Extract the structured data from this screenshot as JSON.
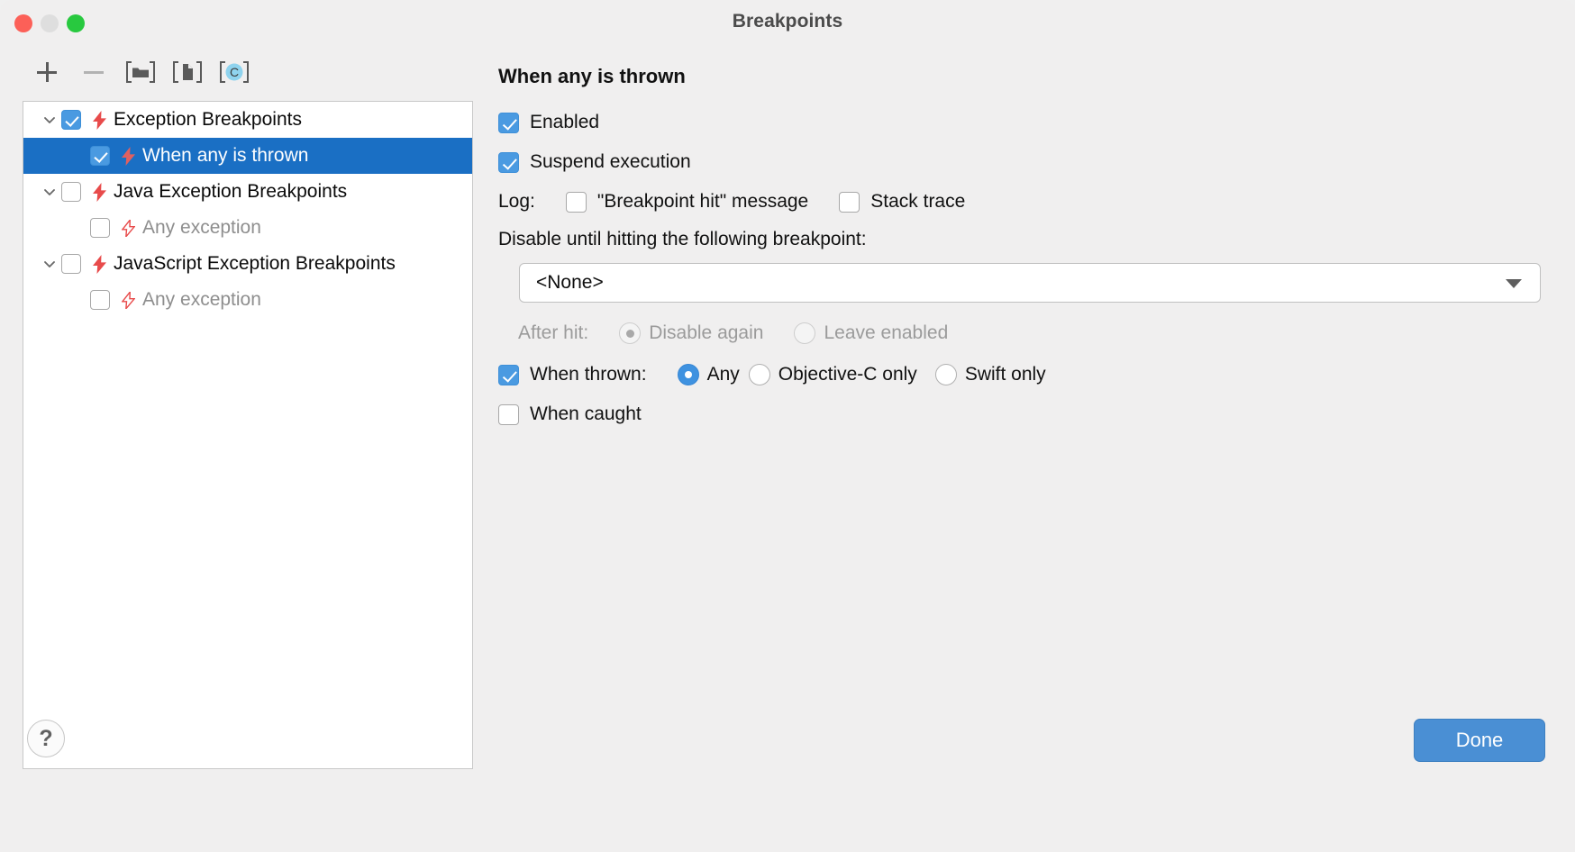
{
  "window": {
    "title": "Breakpoints",
    "traffic_lights": [
      "close",
      "minimize",
      "zoom"
    ]
  },
  "toolbar": {
    "items": [
      {
        "name": "add-breakpoint-button",
        "icon": "plus-icon",
        "label": "+"
      },
      {
        "name": "remove-breakpoint-button",
        "icon": "minus-icon",
        "label": "–"
      },
      {
        "name": "move-to-folder-button",
        "icon": "folder-bracket-icon",
        "label": ""
      },
      {
        "name": "share-breakpoint-button",
        "icon": "file-bracket-icon",
        "label": ""
      },
      {
        "name": "c-breakpoint-button",
        "icon": "c-bracket-icon",
        "label": "C"
      }
    ]
  },
  "list": {
    "rows": [
      {
        "label": "Exception Breakpoints",
        "checkbox": "checked",
        "disclosure": "expanded",
        "icon": "bolt-icon",
        "level": 1,
        "selected": false,
        "dim": false
      },
      {
        "label": "When any is thrown",
        "checkbox": "checked",
        "disclosure": "none",
        "icon": "bolt-icon",
        "level": 2,
        "selected": true,
        "dim": false
      },
      {
        "label": "Java Exception Breakpoints",
        "checkbox": "unchecked",
        "disclosure": "expanded",
        "icon": "bolt-icon",
        "level": 1,
        "selected": false,
        "dim": false
      },
      {
        "label": "Any exception",
        "checkbox": "unchecked",
        "disclosure": "none",
        "icon": "bolt-icon",
        "level": 2,
        "selected": false,
        "dim": true
      },
      {
        "label": "JavaScript Exception Breakpoints",
        "checkbox": "unchecked",
        "disclosure": "expanded",
        "icon": "bolt-icon",
        "level": 1,
        "selected": false,
        "dim": false
      },
      {
        "label": "Any exception",
        "checkbox": "unchecked",
        "disclosure": "none",
        "icon": "bolt-icon",
        "level": 2,
        "selected": false,
        "dim": true
      }
    ]
  },
  "detail": {
    "title": "When any is thrown",
    "enabled": {
      "label": "Enabled",
      "checked": true
    },
    "suspend": {
      "label": "Suspend execution",
      "checked": true
    },
    "log": {
      "label": "Log:",
      "message_option": {
        "label": "\"Breakpoint hit\" message",
        "checked": false
      },
      "stack_option": {
        "label": "Stack trace",
        "checked": false
      }
    },
    "disable_until": {
      "label": "Disable until hitting the following breakpoint:",
      "value": "<None>",
      "placeholder": "<None>"
    },
    "after_hit": {
      "label": "After hit:",
      "enabled": false,
      "options": [
        {
          "label": "Disable again",
          "selected": true
        },
        {
          "label": "Leave enabled",
          "selected": false
        }
      ]
    },
    "when_thrown": {
      "label": "When thrown:",
      "checked": true,
      "options": [
        {
          "label": "Any",
          "selected": true
        },
        {
          "label": "Objective-C only",
          "selected": false
        },
        {
          "label": "Swift only",
          "selected": false
        }
      ]
    },
    "when_caught": {
      "label": "When caught",
      "checked": false
    }
  },
  "footer": {
    "help_label": "?",
    "done_label": "Done"
  },
  "colors": {
    "accent": "#4a9ae1",
    "selection": "#1a6fc4",
    "bolt": "#e84b4b",
    "window_bg": "#f0efef",
    "done_button": "#4a8fd4"
  }
}
